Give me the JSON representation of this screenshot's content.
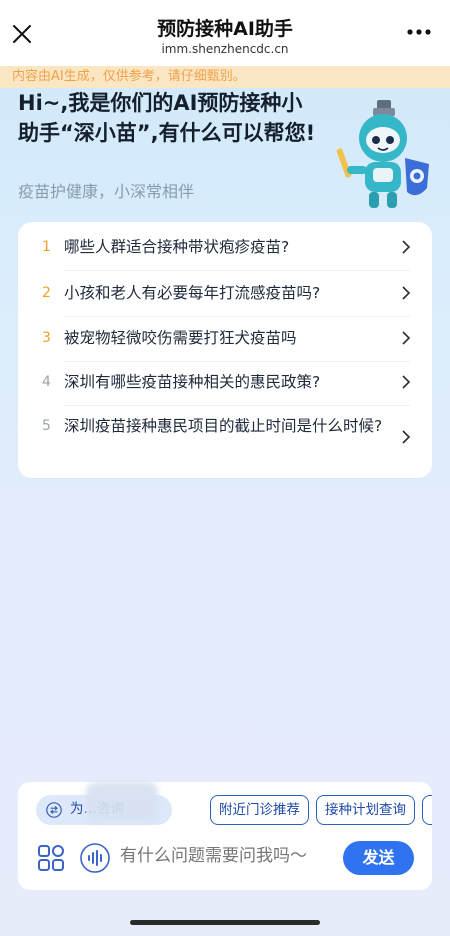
{
  "nav": {
    "title": "预防接种AI助手",
    "url": "imm.shenzhencdc.cn"
  },
  "notice": "内容由AI生成，仅供参考，请仔细甄别。",
  "hero": {
    "title": "Hi~,我是你们的AI预防接种小助手“深小苗”,有什么可以帮您!",
    "subtitle": "疫苗护健康，小深常相伴"
  },
  "questions": [
    {
      "num": "1",
      "text": "哪些人群适合接种带状疱疹疫苗?"
    },
    {
      "num": "2",
      "text": "小孩和老人有必要每年打流感疫苗吗?"
    },
    {
      "num": "3",
      "text": "被宠物轻微咬伤需要打狂犬疫苗吗"
    },
    {
      "num": "4",
      "text": "深圳有哪些疫苗接种相关的惠民政策?"
    },
    {
      "num": "5",
      "text": "深圳疫苗接种惠民项目的截止时间是什么时候?"
    }
  ],
  "chips": [
    "为…咨询",
    "附近门诊推荐",
    "接种计划查询"
  ],
  "input": {
    "placeholder": "有什么问题需要问我吗～"
  },
  "send_label": "发送",
  "colors": {
    "accent": "#2f73f0",
    "notice_bg": "#fbe6c4",
    "notice_text": "#f0a24a",
    "hot_number": "#f0a028"
  }
}
